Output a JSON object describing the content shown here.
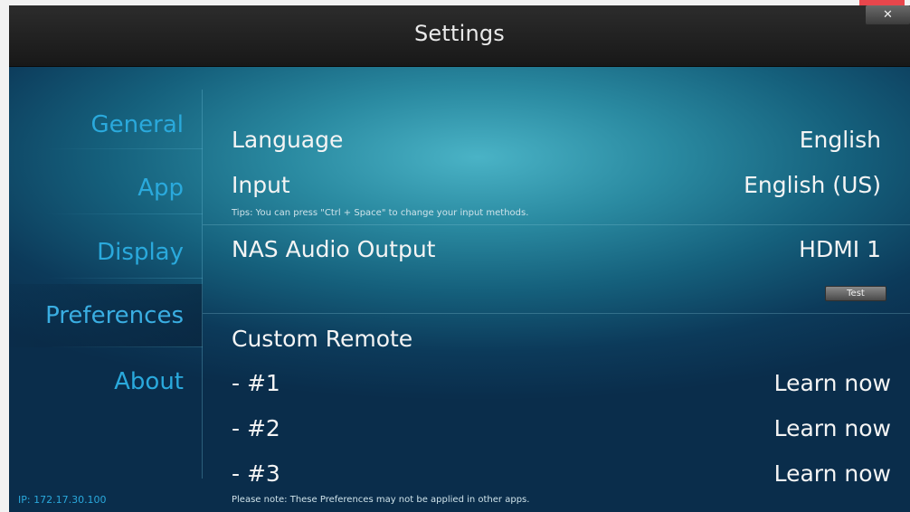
{
  "window": {
    "title": "Settings",
    "close_icon": "✕"
  },
  "sidebar": {
    "items": [
      {
        "label": "General"
      },
      {
        "label": "App"
      },
      {
        "label": "Display"
      },
      {
        "label": "Preferences",
        "active": true
      },
      {
        "label": "About"
      }
    ],
    "ip": "IP: 172.17.30.100"
  },
  "settings": {
    "language": {
      "label": "Language",
      "value": "English"
    },
    "input": {
      "label": "Input",
      "value": "English (US)",
      "tip": "Tips: You can press \"Ctrl + Space\" to change your input methods."
    },
    "audio": {
      "label": "NAS Audio Output",
      "value": "HDMI 1",
      "test_label": "Test"
    },
    "remote": {
      "heading": "Custom Remote",
      "items": [
        {
          "label": "- #1",
          "action": "Learn now"
        },
        {
          "label": "- #2",
          "action": "Learn now"
        },
        {
          "label": "- #3",
          "action": "Learn now"
        }
      ]
    },
    "note": "Please note: These Preferences may not be applied in other apps."
  },
  "colors": {
    "accent": "#2aa9dc",
    "titlebar": "#222222",
    "close_accent": "#e8464c"
  }
}
